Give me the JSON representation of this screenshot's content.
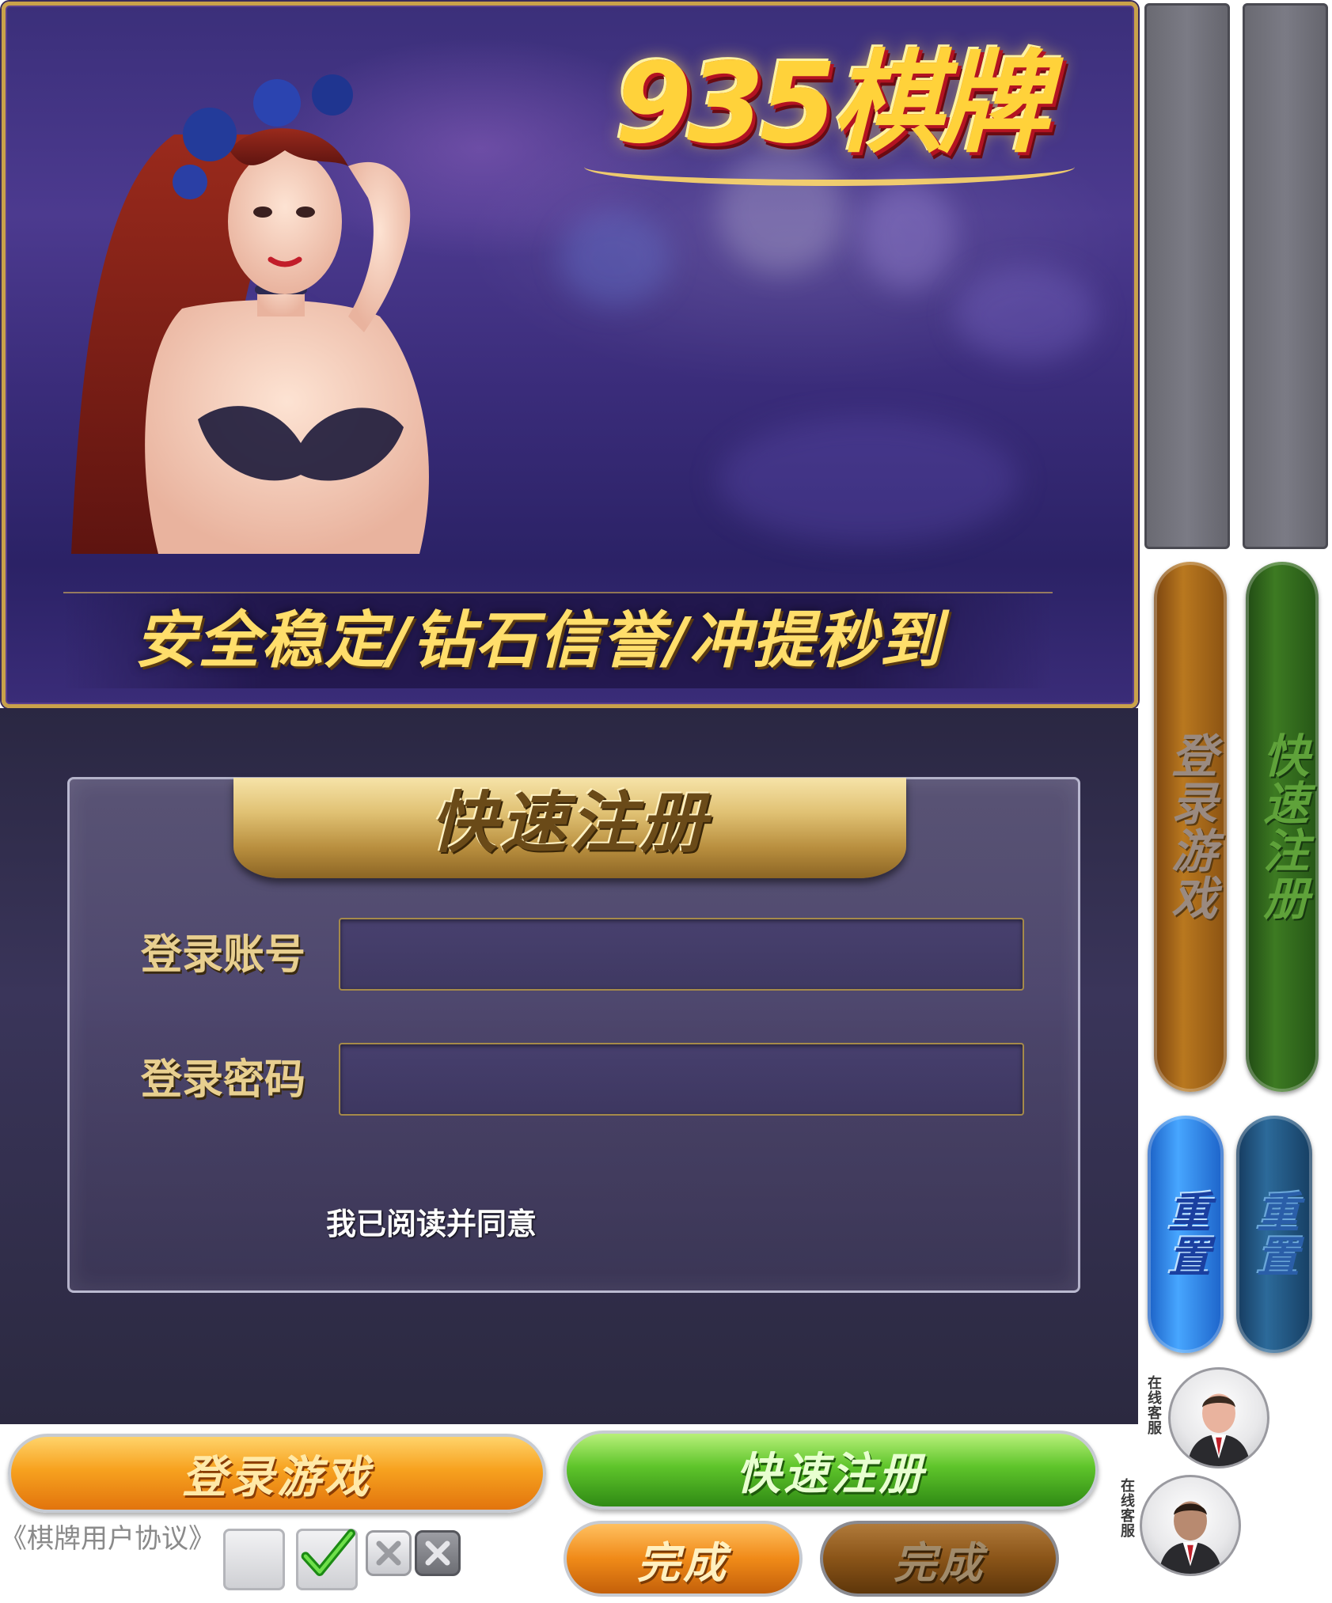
{
  "banner": {
    "logo_text": "935棋牌",
    "slogan": "安全稳定/钻石信誉/冲提秒到"
  },
  "register_panel": {
    "title": "快速注册",
    "account_label": "登录账号",
    "account_value": "",
    "password_label": "登录密码",
    "password_value": "",
    "agree_text": "我已阅读并同意"
  },
  "side_buttons": {
    "login_vertical": "登录游戏",
    "register_vertical": "快速注册",
    "reset_active": "重置",
    "reset_inactive": "重置",
    "customer_service_1": "在线客服",
    "customer_service_2": "在线客服"
  },
  "bottom_buttons": {
    "login": "登录游戏",
    "register": "快速注册",
    "done_active": "完成",
    "done_disabled": "完成",
    "agreement_link": "《棋牌用户协议》"
  },
  "icons": {
    "checkbox_empty": "checkbox-empty-icon",
    "checkbox_checked": "check-icon",
    "close_active": "close-icon",
    "close_disabled": "close-disabled-icon"
  },
  "colors": {
    "gold": "#ffd23a",
    "orange_button": "#f08a18",
    "green_button": "#3ea020",
    "blue_button": "#2a7ad8",
    "banner_purple": "#3b2f7a"
  }
}
